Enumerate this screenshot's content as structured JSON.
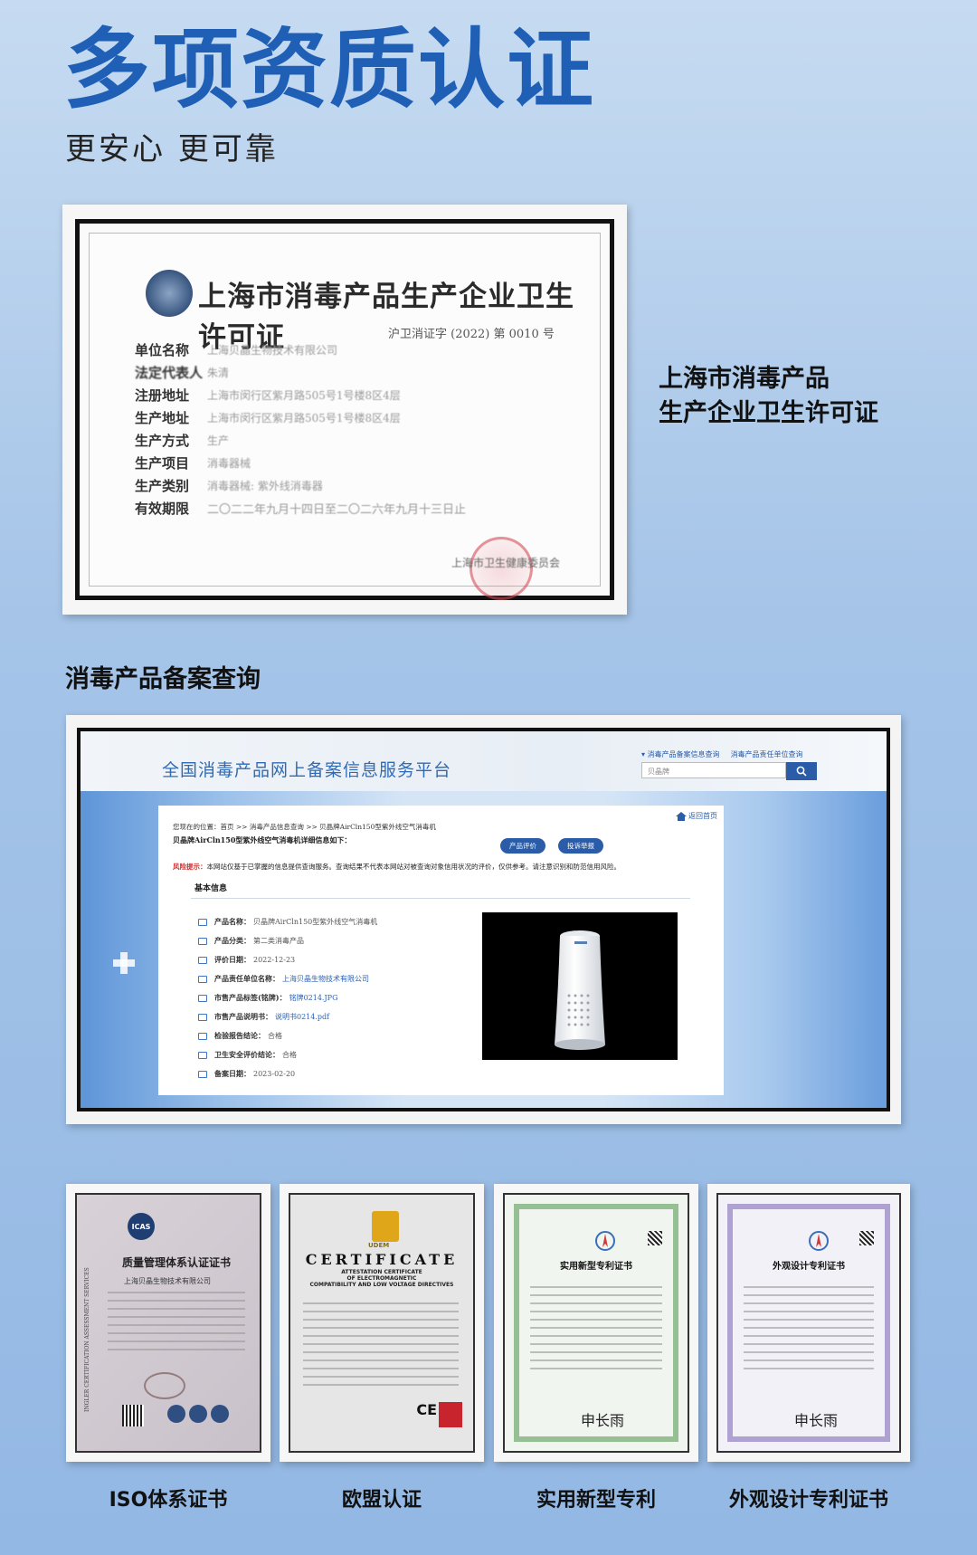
{
  "header": {
    "title": "多项资质认证",
    "subtitle": "更安心 更可靠"
  },
  "permit": {
    "title": "上海市消毒产品生产企业卫生许可证",
    "number": "沪卫消证字 (2022) 第 0010 号",
    "rows": [
      {
        "label": "单位名称",
        "value": "上海贝晶生物技术有限公司"
      },
      {
        "label": "法定代表人",
        "value": "朱清"
      },
      {
        "label": "注册地址",
        "value": "上海市闵行区紫月路505号1号楼8区4层"
      },
      {
        "label": "生产地址",
        "value": "上海市闵行区紫月路505号1号楼8区4层"
      },
      {
        "label": "生产方式",
        "value": "生产"
      },
      {
        "label": "生产项目",
        "value": "消毒器械"
      },
      {
        "label": "生产类别",
        "value": "消毒器械: 紫外线消毒器"
      },
      {
        "label": "有效期限",
        "value": "二〇二二年九月十四日至二〇二六年九月十三日止"
      }
    ],
    "issuer": "上海市卫生健康委员会",
    "caption_line1": "上海市消毒产品",
    "caption_line2": "生产企业卫生许可证"
  },
  "registration": {
    "section_title": "消毒产品备案查询",
    "portal_title": "全国消毒产品网上备案信息服务平台",
    "links": [
      "▾ 消毒产品备案信息查询",
      "消毒产品责任单位查询"
    ],
    "search_value": "贝晶牌",
    "home_link": "返回首页",
    "breadcrumb": "您现在的位置：首页 >> 消毒产品信息查询 >> 贝晶牌AirCln150型紫外线空气消毒机",
    "detail_title": "贝晶牌AirCln150型紫外线空气消毒机详细信息如下：",
    "buttons": [
      "产品评价",
      "投诉举报"
    ],
    "risk_label": "风险提示：",
    "risk_text": "本网站仅基于已掌握的信息提供查询服务。查询结果不代表本网站对被查询对象信用状况的评价，仅供参考。请注意识别和防范信用风险。",
    "tab_label": "基本信息",
    "fields": [
      {
        "label": "产品名称：",
        "value": "贝晶牌AirCln150型紫外线空气消毒机"
      },
      {
        "label": "产品分类：",
        "value": "第二类消毒产品"
      },
      {
        "label": "评价日期：",
        "value": "2022-12-23"
      },
      {
        "label": "产品责任单位名称：",
        "value": "上海贝晶生物技术有限公司"
      },
      {
        "label": "市售产品标签(铭牌)：",
        "value": "铭牌0214.JPG"
      },
      {
        "label": "市售产品说明书：",
        "value": "说明书0214.pdf"
      },
      {
        "label": "检验报告结论：",
        "value": "合格"
      },
      {
        "label": "卫生安全评价结论：",
        "value": "合格"
      },
      {
        "label": "备案日期：",
        "value": "2023-02-20"
      }
    ]
  },
  "certificates": [
    {
      "caption": "ISO体系证书",
      "title": "质量管理体系认证证书",
      "org": "上海贝晶生物技术有限公司",
      "side_text": "INGLER CERTIFICATION ASSESSMENT SERVICES",
      "logo_text": "ICAS"
    },
    {
      "caption": "欧盟认证",
      "title": "CERTIFICATE",
      "sub1": "ATTESTATION CERTIFICATE",
      "sub2": "OF ELECTROMAGNETIC",
      "sub3": "COMPATIBILITY AND LOW VOLTAGE DIRECTIVES",
      "logo_text": "UDEM",
      "mark": "CE"
    },
    {
      "caption": "实用新型专利",
      "title": "实用新型专利证书",
      "signature": "申长雨"
    },
    {
      "caption": "外观设计专利证书",
      "title": "外观设计专利证书",
      "signature": "申长雨"
    }
  ],
  "colors": {
    "title_blue": "#1f5fb6",
    "portal_blue": "#2a5ca8",
    "risk_red": "#d0302f"
  }
}
